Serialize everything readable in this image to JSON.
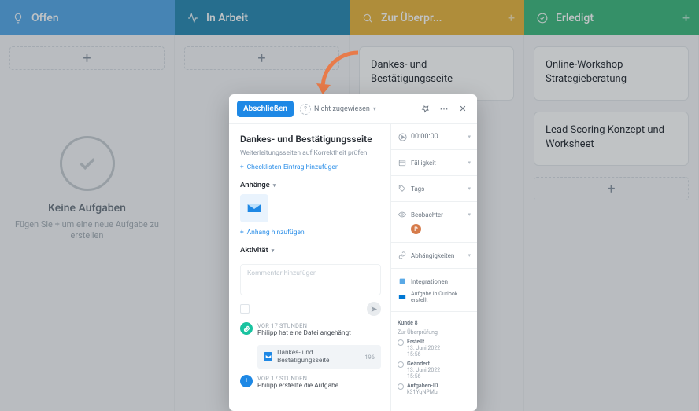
{
  "columns": {
    "open": {
      "label": "Offen"
    },
    "prog": {
      "label": "In Arbeit"
    },
    "rev": {
      "label": "Zur Überpr..."
    },
    "done": {
      "label": "Erledigt"
    }
  },
  "lanes": {
    "open_empty": {
      "title": "Keine Aufgaben",
      "sub": "Fügen Sie + um eine\nneue Aufgabe zu erstellen"
    },
    "rev_card1": "Dankes- und Bestätigungsseite",
    "done_card1": "Online-Workshop Strategieberatung",
    "done_card2": "Lead Scoring Konzept und Worksheet"
  },
  "modal": {
    "close_btn": "Abschließen",
    "assignee": "Nicht zugewiesen",
    "title": "Dankes- und Bestätigungsseite",
    "desc": "Weiterleitungsseiten auf Korrektheit prüfen",
    "add_checklist": "Checklisten-Eintrag hinzufügen",
    "attachments_label": "Anhänge",
    "add_attachment": "Anhang hinzufügen",
    "activity_label": "Aktivität",
    "comment_placeholder": "Kommentar hinzufügen",
    "act1": {
      "time": "VOR 17 STUNDEN",
      "line": "Philipp hat eine Datei angehängt"
    },
    "file_chip": {
      "name": "Dankes- und Bestätigungsseite",
      "size": "196"
    },
    "act2": {
      "time": "VOR 17 STUNDEN",
      "line": "Philipp erstellte die Aufgabe"
    }
  },
  "sidebar": {
    "timer": "00:00:00",
    "due": "Fälligkeit",
    "tags": "Tags",
    "watchers": "Beobachter",
    "deps": "Abhängigkeiten",
    "integrations": "Integrationen",
    "outlook": "Aufgabe in Outlook erstellt",
    "kunde_label": "Kunde 8",
    "kunde_status": "Zur Überprüfung",
    "created_label": "Erstellt",
    "created_date": "13. Juni 2022",
    "created_time": "15:56",
    "changed_label": "Geändert",
    "changed_date": "13. Juni 2022",
    "changed_time": "15:56",
    "task_id_label": "Aufgaben-ID",
    "task_id": "k31YqNPMu"
  }
}
